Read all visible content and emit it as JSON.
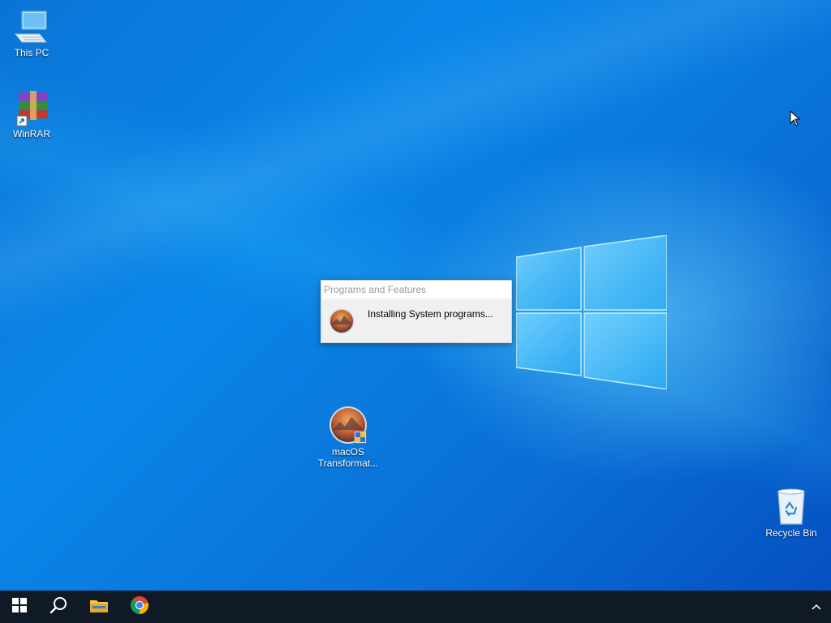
{
  "desktop": {
    "icons": [
      {
        "label": "This PC",
        "icon": "computer-icon"
      },
      {
        "label": "WinRAR",
        "icon": "winrar-icon"
      },
      {
        "label": "macOS Transformat...",
        "icon": "macos-installer-icon"
      },
      {
        "label": "Recycle Bin",
        "icon": "recycle-bin-icon"
      }
    ]
  },
  "dialog": {
    "title": "Programs and Features",
    "message": "Installing System programs...",
    "icon": "macos-installer-icon"
  },
  "taskbar": {
    "items": [
      {
        "name": "start",
        "icon": "windows-logo-icon"
      },
      {
        "name": "search",
        "icon": "search-icon"
      },
      {
        "name": "file-explorer",
        "icon": "folder-icon"
      },
      {
        "name": "chrome",
        "icon": "chrome-icon"
      }
    ],
    "tray_icon": "chevron-up-icon"
  },
  "colors": {
    "desktop_blue": "#0a86e8",
    "taskbar": "#0f1a26",
    "dialog_bg": "#f0f0f0"
  }
}
